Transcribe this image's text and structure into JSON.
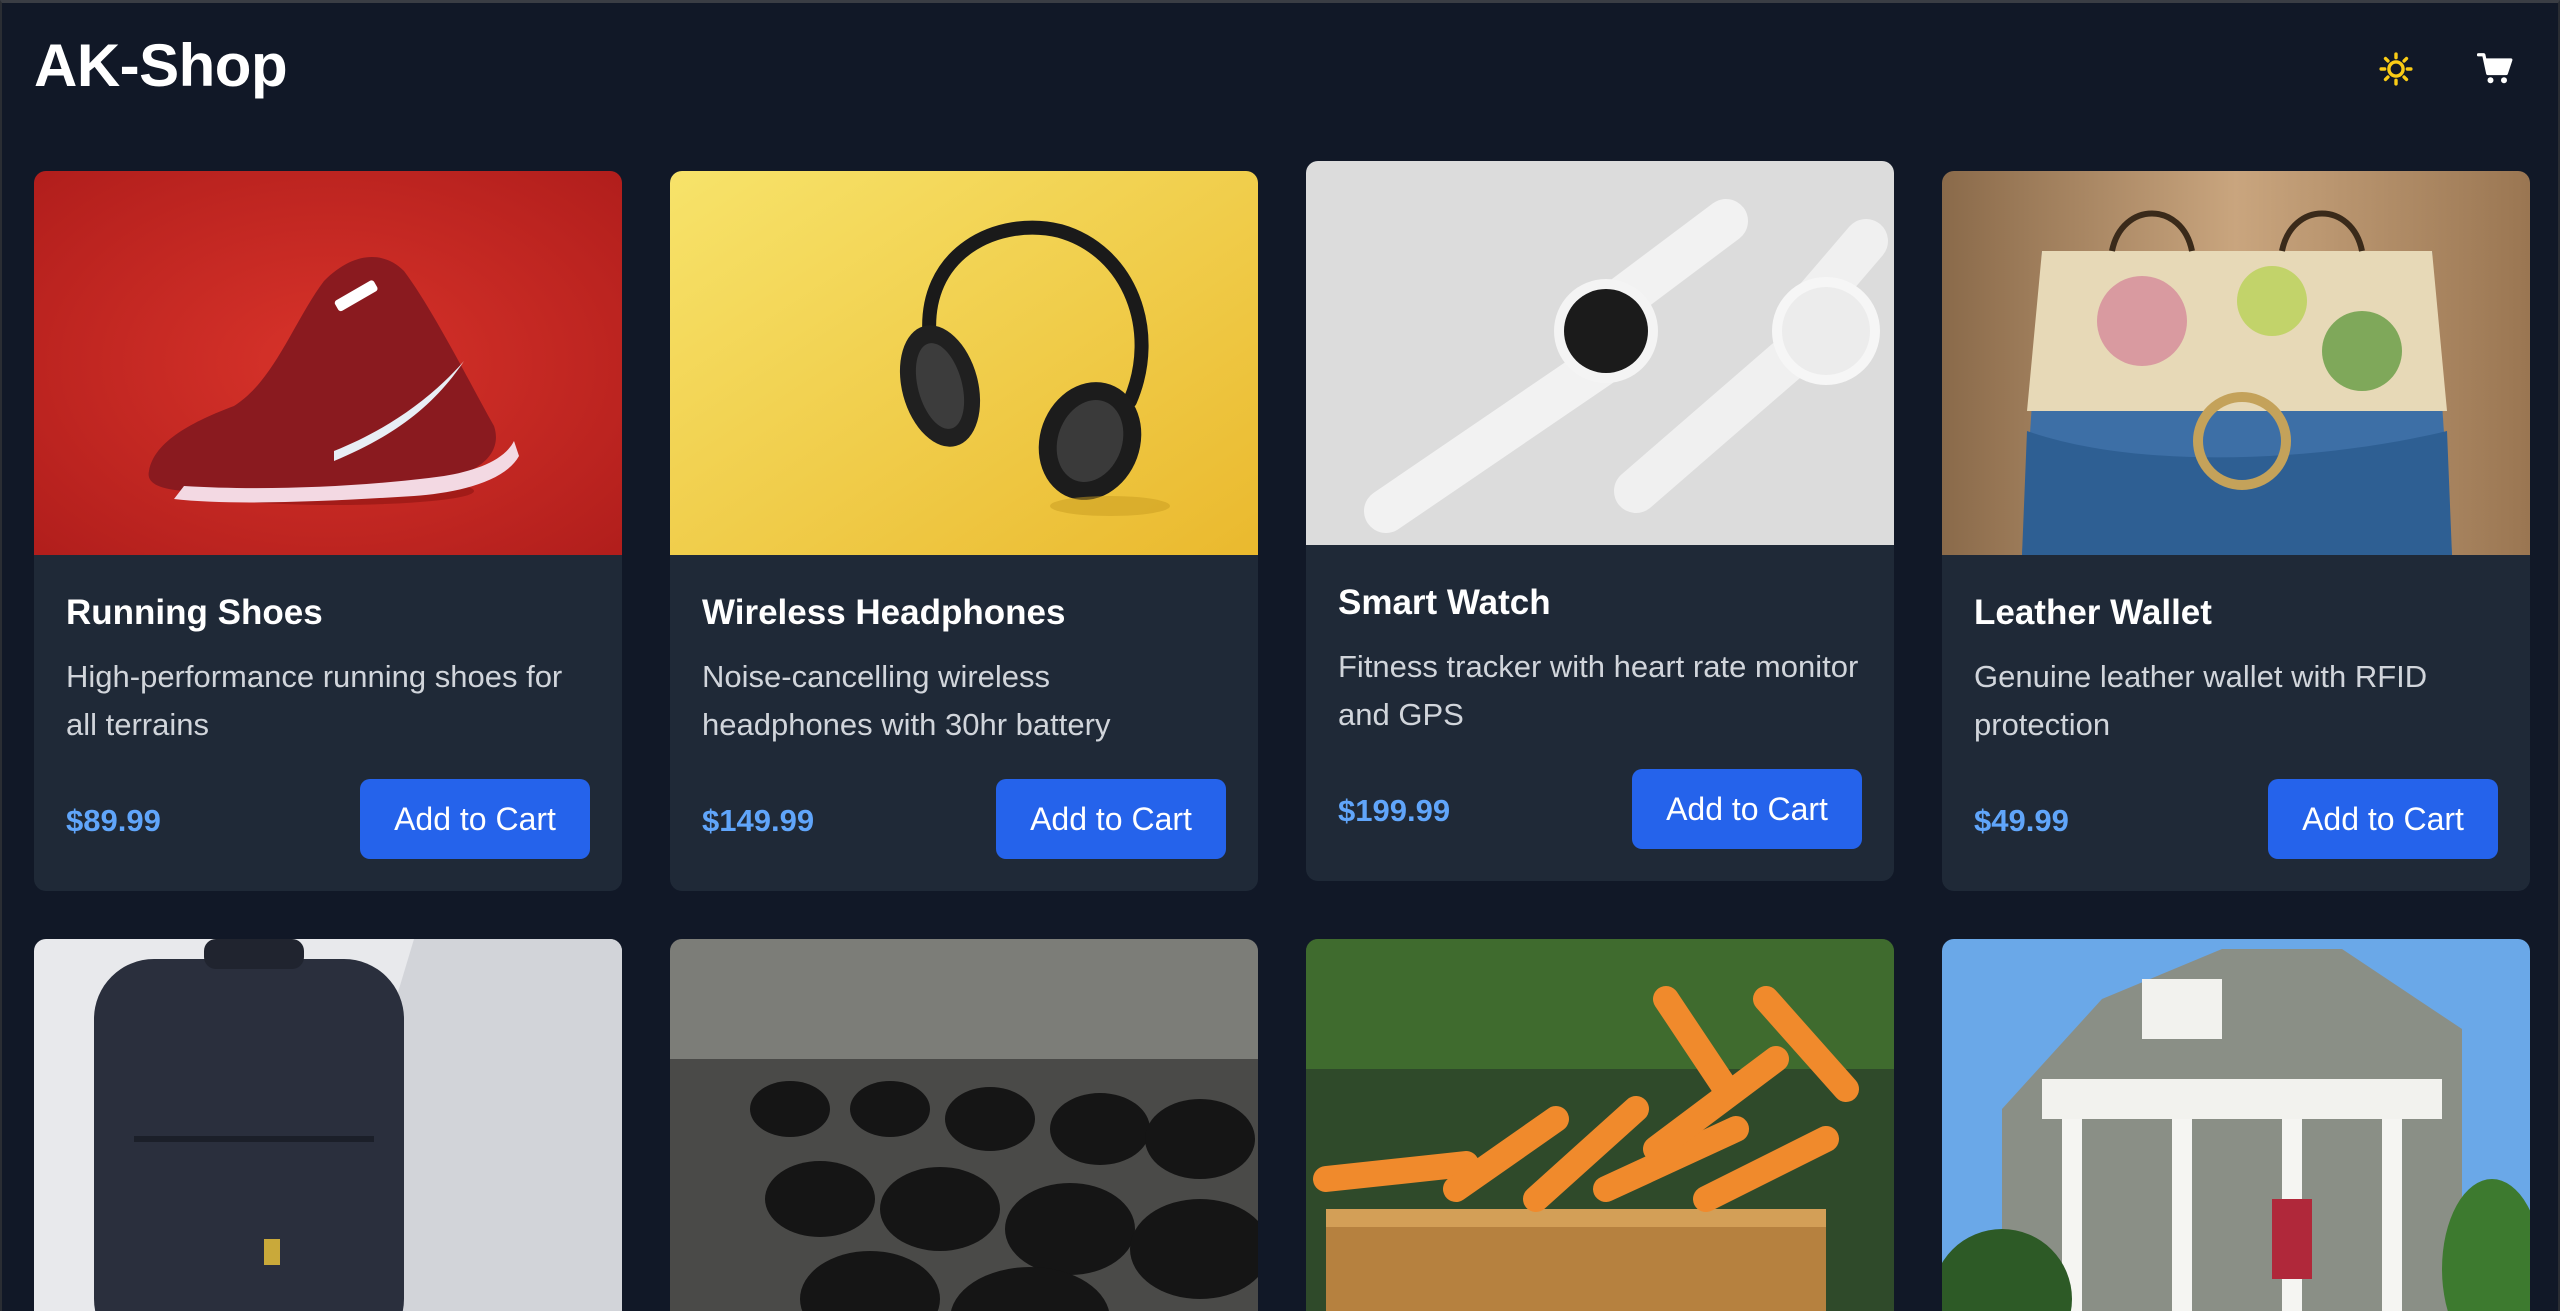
{
  "header": {
    "logo": "AK-Shop",
    "theme_icon": "sun-icon",
    "cart_icon": "shopping-cart-icon"
  },
  "products": [
    {
      "name": "Running Shoes",
      "desc": "High-performance running shoes for all terrains",
      "price": "$89.99",
      "button": "Add to Cart"
    },
    {
      "name": "Wireless Headphones",
      "desc": "Noise-cancelling wireless headphones with 30hr battery",
      "price": "$149.99",
      "button": "Add to Cart"
    },
    {
      "name": "Smart Watch",
      "desc": "Fitness tracker with heart rate monitor and GPS",
      "price": "$199.99",
      "button": "Add to Cart"
    },
    {
      "name": "Leather Wallet",
      "desc": "Genuine leather wallet with RFID protection",
      "price": "$49.99",
      "button": "Add to Cart"
    }
  ],
  "colors": {
    "background": "#111827",
    "card": "#1f2937",
    "accent": "#2563eb",
    "price": "#60a5fa",
    "sun": "#facc15"
  }
}
